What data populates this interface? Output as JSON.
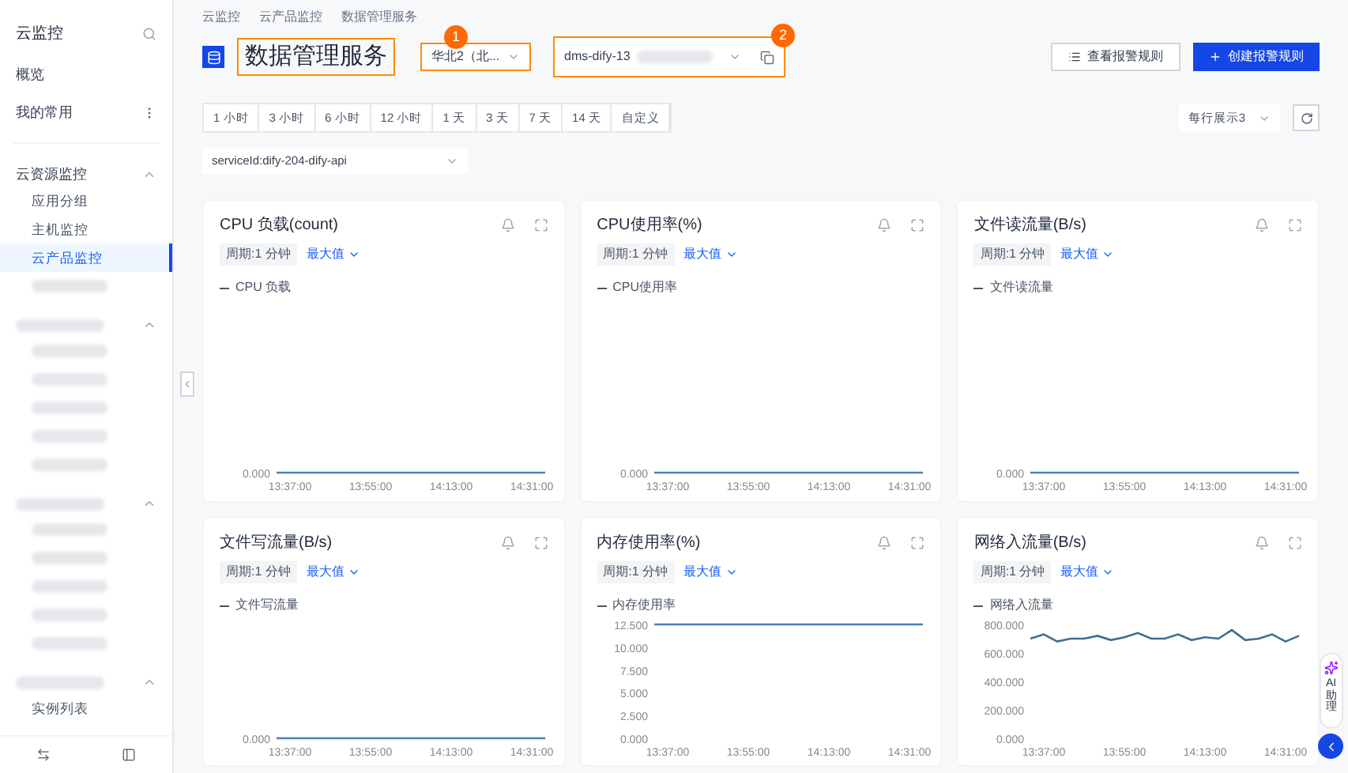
{
  "sidebar": {
    "title": "云监控",
    "items": [
      {
        "label": "概览",
        "kind": "link"
      },
      {
        "label": "我的常用",
        "kind": "menu"
      }
    ],
    "groups": [
      {
        "kind": "text",
        "label": "云资源监控",
        "expanded": true,
        "children": [
          {
            "kind": "text",
            "label": "应用分组",
            "selected": false
          },
          {
            "kind": "text",
            "label": "主机监控",
            "selected": false
          },
          {
            "kind": "text",
            "label": "云产品监控",
            "selected": true
          },
          {
            "kind": "redacted",
            "selected": false
          }
        ]
      },
      {
        "kind": "redacted",
        "expanded": true,
        "children": [
          {
            "kind": "redacted",
            "selected": false
          },
          {
            "kind": "redacted",
            "selected": false
          },
          {
            "kind": "redacted",
            "selected": false
          },
          {
            "kind": "redacted",
            "selected": false
          },
          {
            "kind": "redacted",
            "selected": false
          }
        ]
      },
      {
        "kind": "redacted",
        "expanded": true,
        "children": [
          {
            "kind": "redacted",
            "selected": false
          },
          {
            "kind": "redacted",
            "selected": false
          },
          {
            "kind": "redacted",
            "selected": false
          },
          {
            "kind": "redacted",
            "selected": false
          },
          {
            "kind": "redacted",
            "selected": false
          }
        ]
      },
      {
        "kind": "redacted",
        "expanded": true,
        "children": [
          {
            "kind": "text",
            "label": "实例列表",
            "selected": false
          }
        ]
      }
    ]
  },
  "breadcrumb": [
    "云监控",
    "云产品监控",
    "数据管理服务"
  ],
  "header": {
    "title": "数据管理服务",
    "region_select": {
      "value": "华北2（北...",
      "badge": "1"
    },
    "instance_select": {
      "value": "dms-dify-13",
      "redacted": true,
      "badge": "2"
    },
    "buttons": [
      {
        "label": "查看报警规则",
        "kind": "secondary"
      },
      {
        "label": "创建报警规则",
        "kind": "primary"
      }
    ]
  },
  "time_ranges": [
    {
      "label": "1 小时",
      "selected": false
    },
    {
      "label": "3 小时",
      "selected": false
    },
    {
      "label": "6 小时",
      "selected": false
    },
    {
      "label": "12 小时",
      "selected": false
    },
    {
      "label": "1 天",
      "selected": false
    },
    {
      "label": "3 天",
      "selected": false
    },
    {
      "label": "7 天",
      "selected": false
    },
    {
      "label": "14 天",
      "selected": false
    },
    {
      "label": "自定义",
      "selected": false
    }
  ],
  "per_row_select": {
    "value": "每行展示3"
  },
  "service_select": {
    "value": "serviceId:dify-204-dify-api"
  },
  "cards": [
    {
      "title": "CPU 负载(count)",
      "period": "周期:1 分钟",
      "aggregate": "最大值",
      "legend": "CPU 负载",
      "plot": {
        "y_label": "0.000",
        "x_labels": [
          "13:37:00",
          "13:55:00",
          "14:13:00",
          "14:31:00"
        ]
      }
    },
    {
      "title": "CPU使用率(%)",
      "period": "周期:1 分钟",
      "aggregate": "最大值",
      "legend": "CPU使用率",
      "plot": {
        "y_label": "0.000",
        "x_labels": [
          "13:37:00",
          "13:55:00",
          "14:13:00",
          "14:31:00"
        ]
      }
    },
    {
      "title": "文件读流量(B/s)",
      "period": "周期:1 分钟",
      "aggregate": "最大值",
      "legend": "文件读流量",
      "plot": {
        "y_label": "0.000",
        "x_labels": [
          "13:37:00",
          "13:55:00",
          "14:13:00",
          "14:31:00"
        ]
      }
    },
    {
      "title": "文件写流量(B/s)",
      "period": "周期:1 分钟",
      "aggregate": "最大值",
      "legend": "文件写流量",
      "plot": {
        "y_label": "0.000",
        "x_labels": [
          "13:37:00",
          "13:55:00",
          "14:13:00",
          "14:31:00"
        ]
      }
    },
    {
      "title": "内存使用率(%)",
      "period": "周期:1 分钟",
      "aggregate": "最大值",
      "chart_data": {
        "type": "line",
        "categories": [
          null,
          "13:37:00",
          null,
          null,
          null,
          null,
          null,
          "13:55:00",
          null,
          null,
          null,
          null,
          null,
          "14:13:00",
          null,
          null,
          null,
          null,
          null,
          "14:31:00",
          null
        ],
        "series": [
          {
            "name": "内存使用率",
            "color": "#4a7fb5",
            "values": [
              12.5,
              12.5,
              12.5,
              12.5,
              12.5,
              12.5,
              12.5,
              12.5,
              12.5,
              12.5,
              12.5,
              12.5,
              12.5,
              12.5,
              12.5,
              12.5,
              12.5,
              12.5,
              12.5,
              12.5,
              12.5
            ]
          }
        ],
        "ylim": [
          0,
          12.5
        ],
        "yticks": [
          {
            "value": 0,
            "label": "0.000"
          },
          {
            "value": 2.5,
            "label": "2.500"
          },
          {
            "value": 5,
            "label": "5.000"
          },
          {
            "value": 7.5,
            "label": "7.500"
          },
          {
            "value": 10,
            "label": "10.000"
          },
          {
            "value": 12.5,
            "label": "12.500"
          }
        ]
      }
    },
    {
      "title": "网络入流量(B/s)",
      "period": "周期:1 分钟",
      "aggregate": "最大值",
      "chart_data": {
        "type": "line",
        "categories": [
          null,
          "13:37:00",
          null,
          null,
          null,
          null,
          null,
          "13:55:00",
          null,
          null,
          null,
          null,
          null,
          "14:13:00",
          null,
          null,
          null,
          null,
          null,
          "14:31:00",
          null
        ],
        "series": [
          {
            "name": "网络入流量",
            "color": "#3d6f8f",
            "values": [
              700,
              730,
              680,
              700,
              700,
              720,
              690,
              710,
              740,
              700,
              700,
              730,
              690,
              710,
              700,
              760,
              690,
              700,
              730,
              680,
              720
            ]
          }
        ],
        "ylim": [
          0,
          800
        ],
        "yticks": [
          {
            "value": 0,
            "label": "0.000"
          },
          {
            "value": 200,
            "label": "200.000"
          },
          {
            "value": 400,
            "label": "400.000"
          },
          {
            "value": 600,
            "label": "600.000"
          },
          {
            "value": 800,
            "label": "800.000"
          }
        ]
      }
    }
  ],
  "assistant": {
    "label": "AI助理"
  }
}
